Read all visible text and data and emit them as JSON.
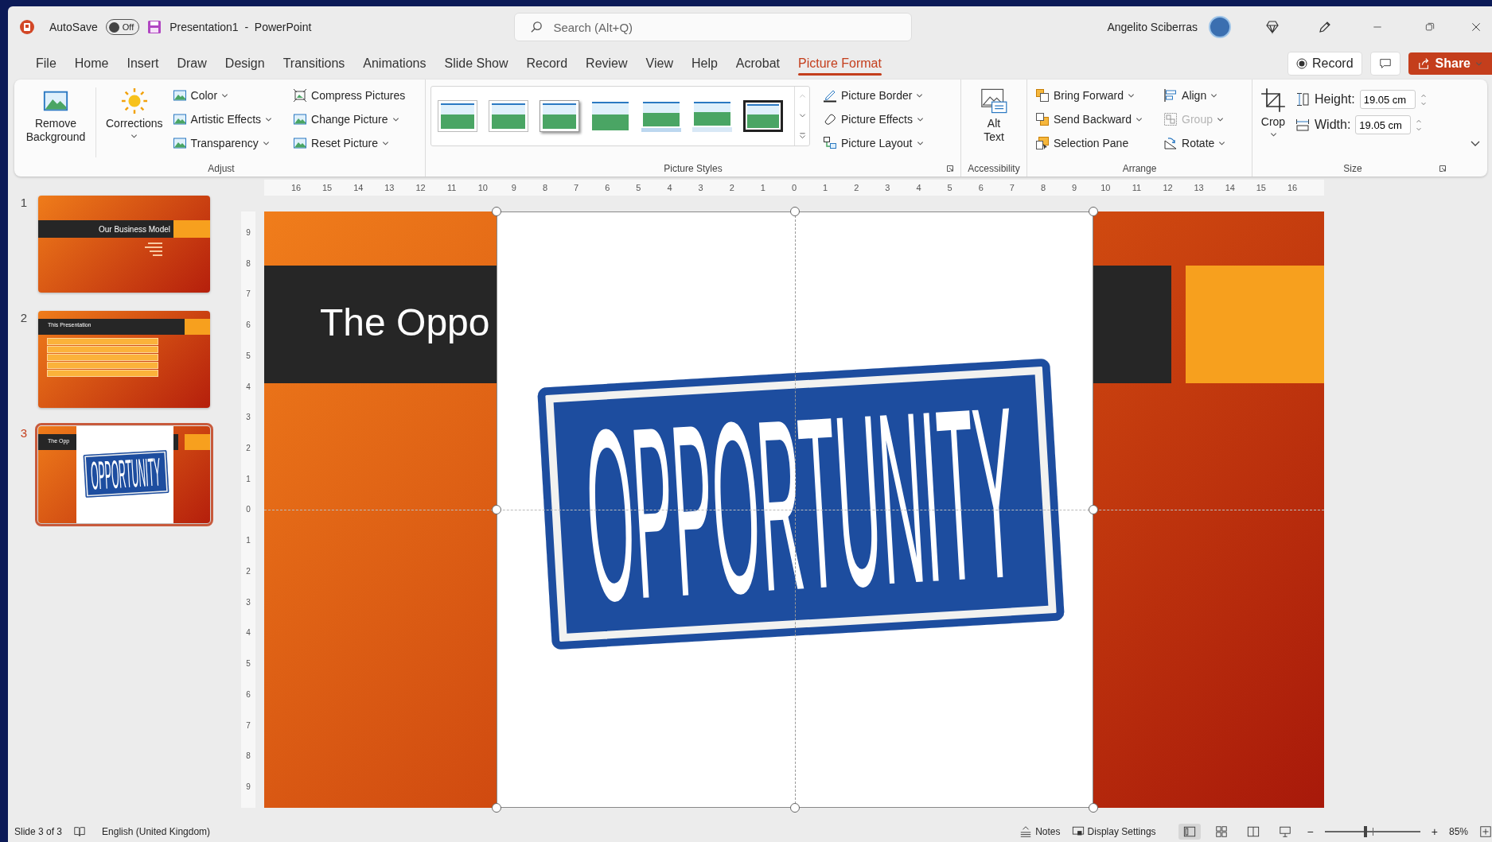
{
  "title_bar": {
    "autosave": {
      "label": "AutoSave",
      "toggle_text": "Off",
      "on": false
    },
    "document_title": "Presentation1  -  PowerPoint",
    "search": {
      "placeholder": "Search (Alt+Q)"
    },
    "user_name": "Angelito Sciberras"
  },
  "tabs": [
    {
      "label": "File",
      "selected": false
    },
    {
      "label": "Home",
      "selected": false
    },
    {
      "label": "Insert",
      "selected": false
    },
    {
      "label": "Draw",
      "selected": false
    },
    {
      "label": "Design",
      "selected": false
    },
    {
      "label": "Transitions",
      "selected": false
    },
    {
      "label": "Animations",
      "selected": false
    },
    {
      "label": "Slide Show",
      "selected": false
    },
    {
      "label": "Record",
      "selected": false
    },
    {
      "label": "Review",
      "selected": false
    },
    {
      "label": "View",
      "selected": false
    },
    {
      "label": "Help",
      "selected": false
    },
    {
      "label": "Acrobat",
      "selected": false
    },
    {
      "label": "Picture Format",
      "selected": true
    }
  ],
  "tab_actions": {
    "record": "Record",
    "share": "Share"
  },
  "ribbon": {
    "adjust": {
      "label": "Adjust",
      "large": [
        {
          "label": "Remove Background",
          "dropdown": false
        },
        {
          "label": "Corrections",
          "dropdown": true
        }
      ],
      "small": [
        {
          "label": "Color",
          "dropdown": true
        },
        {
          "label": "Artistic Effects",
          "dropdown": true
        },
        {
          "label": "Transparency",
          "dropdown": true
        },
        {
          "label": "Compress Pictures",
          "dropdown": false
        },
        {
          "label": "Change Picture",
          "dropdown": true
        },
        {
          "label": "Reset Picture",
          "dropdown": true
        }
      ]
    },
    "picture_styles": {
      "label": "Picture Styles",
      "styles": [
        {
          "kind": "plain"
        },
        {
          "kind": "plain"
        },
        {
          "kind": "shadow"
        },
        {
          "kind": "soft"
        },
        {
          "kind": "reflection"
        },
        {
          "kind": "fade"
        },
        {
          "kind": "frame"
        }
      ],
      "small": [
        {
          "label": "Picture Border",
          "dropdown": true
        },
        {
          "label": "Picture Effects",
          "dropdown": true
        },
        {
          "label": "Picture Layout",
          "dropdown": true
        }
      ]
    },
    "accessibility": {
      "label": "Accessibility",
      "button": "Alt Text"
    },
    "arrange": {
      "label": "Arrange",
      "small": [
        {
          "label": "Bring Forward",
          "dropdown": true,
          "disabled": false
        },
        {
          "label": "Send Backward",
          "dropdown": true,
          "disabled": false
        },
        {
          "label": "Selection Pane",
          "dropdown": false,
          "disabled": false
        },
        {
          "label": "Align",
          "dropdown": true,
          "disabled": false
        },
        {
          "label": "Group",
          "dropdown": true,
          "disabled": true
        },
        {
          "label": "Rotate",
          "dropdown": true,
          "disabled": false
        }
      ]
    },
    "size": {
      "label": "Size",
      "crop": {
        "label": "Crop",
        "dropdown": true
      },
      "height": {
        "label": "Height:",
        "value": "19.05 cm"
      },
      "width": {
        "label": "Width:",
        "value": "19.05 cm"
      }
    }
  },
  "rulers": {
    "horizontal": [
      "16",
      "15",
      "14",
      "13",
      "12",
      "11",
      "10",
      "9",
      "8",
      "7",
      "6",
      "5",
      "4",
      "3",
      "2",
      "1",
      "0",
      "1",
      "2",
      "3",
      "4",
      "5",
      "6",
      "7",
      "8",
      "9",
      "10",
      "11",
      "12",
      "13",
      "14",
      "15",
      "16"
    ],
    "vertical": [
      "9",
      "8",
      "7",
      "6",
      "5",
      "4",
      "3",
      "2",
      "1",
      "0",
      "1",
      "2",
      "3",
      "4",
      "5",
      "6",
      "7",
      "8",
      "9"
    ]
  },
  "slides": [
    {
      "number": "1",
      "kind": "title",
      "title": "Our Business Model",
      "selected": false
    },
    {
      "number": "2",
      "kind": "list",
      "title": "This Presentation",
      "selected": false
    },
    {
      "number": "3",
      "kind": "picture",
      "title": "The Opp",
      "sign_text": "OPPORTUNITY",
      "selected": true
    }
  ],
  "editor": {
    "title": "The Oppo",
    "sign_text": "OPPORTUNITY"
  },
  "status_bar": {
    "slide_info": "Slide 3 of 3",
    "language": "English (United Kingdom)",
    "notes": "Notes",
    "display_settings": "Display Settings",
    "views": [
      {
        "kind": "normal",
        "selected": true
      },
      {
        "kind": "sorter",
        "selected": false
      },
      {
        "kind": "reading",
        "selected": false
      },
      {
        "kind": "slideshow",
        "selected": false
      }
    ],
    "zoom_out": "−",
    "zoom_slider": {
      "level": 0.43
    },
    "zoom_in": "+",
    "zoom_percent": "85%"
  }
}
